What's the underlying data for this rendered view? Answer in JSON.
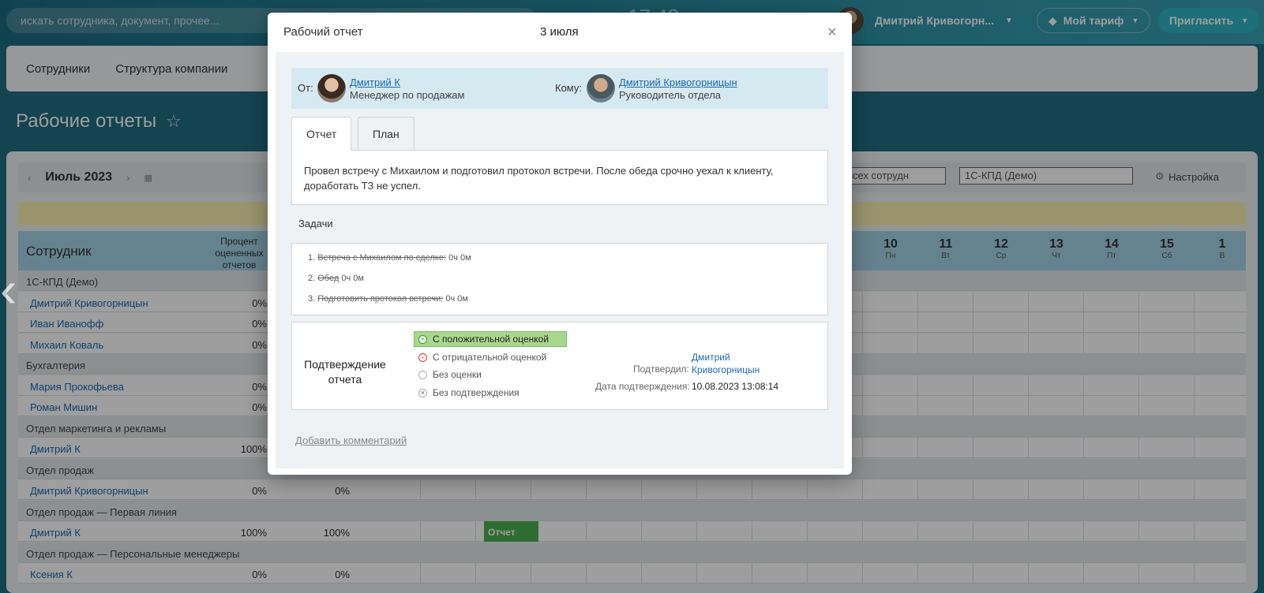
{
  "topbar": {
    "search_placeholder": "искать сотрудника, документ, прочее...",
    "clock": "17:43",
    "user_name": "Дмитрий Кривогорн...",
    "tariff": "Мой тариф",
    "invite": "Пригласить"
  },
  "nav": {
    "items": [
      "Сотрудники",
      "Структура компании"
    ]
  },
  "page": {
    "title": "Рабочие отчеты"
  },
  "toolbar": {
    "month": "Июль 2023",
    "filter_employees": "ать всех сотрудн",
    "filter_company": "1С-КПД (Демо)",
    "settings": "Настройка"
  },
  "table": {
    "col_employee": "Сотрудник",
    "col_percent": "Процент оцененных отчетов",
    "days": [
      {
        "num": "10",
        "dow": "Пн"
      },
      {
        "num": "11",
        "dow": "Вт"
      },
      {
        "num": "12",
        "dow": "Ср"
      },
      {
        "num": "13",
        "dow": "Чт"
      },
      {
        "num": "14",
        "dow": "Пт"
      },
      {
        "num": "15",
        "dow": "Сб"
      },
      {
        "num": "1",
        "dow": "В"
      }
    ],
    "rows": [
      {
        "type": "group",
        "label": "1С-КПД (Демо)"
      },
      {
        "type": "emp",
        "name": "Дмитрий Кривогорницын",
        "p1": "0%",
        "p2": ""
      },
      {
        "type": "emp",
        "name": "Иван Иванофф",
        "p1": "0%",
        "p2": ""
      },
      {
        "type": "emp",
        "name": "Михаил Коваль",
        "p1": "0%",
        "p2": ""
      },
      {
        "type": "group",
        "label": "Бухгалтерия"
      },
      {
        "type": "emp",
        "name": "Мария Прокофьева",
        "p1": "0%",
        "p2": ""
      },
      {
        "type": "emp",
        "name": "Роман Мишин",
        "p1": "0%",
        "p2": ""
      },
      {
        "type": "group",
        "label": "Отдел маркетинга и рекламы"
      },
      {
        "type": "emp",
        "name": "Дмитрий К",
        "p1": "100%",
        "p2": ""
      },
      {
        "type": "group",
        "label": "Отдел продаж"
      },
      {
        "type": "emp",
        "name": "Дмитрий Кривогорницын",
        "p1": "0%",
        "p2": "0%"
      },
      {
        "type": "group",
        "label": "Отдел продаж — Первая линия"
      },
      {
        "type": "emp",
        "name": "Дмитрий К",
        "p1": "100%",
        "p2": "100%",
        "chip": "Отчет"
      },
      {
        "type": "group",
        "label": "Отдел продаж — Персональные менеджеры"
      },
      {
        "type": "emp",
        "name": "Ксения К",
        "p1": "0%",
        "p2": "0%"
      }
    ]
  },
  "modal": {
    "title": "Рабочий отчет",
    "date": "3 июля",
    "close": "×",
    "from_label": "От:",
    "from_name": "Дмитрий К",
    "from_role": "Менеджер по продажам",
    "to_label": "Кому:",
    "to_name": "Дмитрий Кривогорницын",
    "to_role": "Руководитель отдела",
    "tab_report": "Отчет",
    "tab_plan": "План",
    "report_text": "Провел встречу с Михаилом и подготовил протокол встречи. После обеда срочно уехал к клиенту, доработать ТЗ не успел.",
    "tasks_header": "Задачи",
    "tasks": [
      {
        "n": "1.",
        "title": "Встреча с Михаилом по сделке:",
        "time": "0ч 0м"
      },
      {
        "n": "2.",
        "title": "Обед",
        "time": "0ч 0м"
      },
      {
        "n": "3.",
        "title": "Подготовить протокол встречи:",
        "time": "0ч 0м"
      }
    ],
    "confirm_title": "Подтверждение отчета",
    "options": [
      "С положительной оценкой",
      "С отрицательной оценкой",
      "Без оценки",
      "Без подтверждения"
    ],
    "confirmed_by_label": "Подтвердил:",
    "confirmed_by": "Дмитрий Кривогорницын",
    "confirm_date_label": "Дата подтверждения:",
    "confirm_date": "10.08.2023 13:08:14",
    "add_comment": "Добавить комментарий"
  }
}
